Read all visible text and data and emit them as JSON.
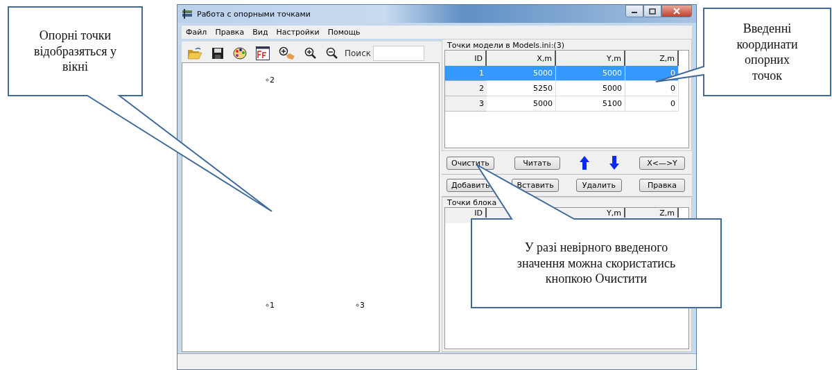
{
  "window": {
    "title": "Работа с опорными точками"
  },
  "menu": [
    {
      "label": "Файл"
    },
    {
      "label": "Правка"
    },
    {
      "label": "Вид"
    },
    {
      "label": "Настройки"
    },
    {
      "label": "Помощь"
    }
  ],
  "toolbar": {
    "tools": [
      {
        "kind": "open"
      },
      {
        "kind": "save"
      },
      {
        "kind": "palette"
      },
      {
        "kind": "font"
      },
      {
        "kind": "zoom-hand"
      },
      {
        "kind": "zoom-in"
      },
      {
        "kind": "zoom-out"
      }
    ],
    "search_label": "Поиск"
  },
  "canvas": {
    "points": [
      {
        "label": "1"
      },
      {
        "label": "2"
      },
      {
        "label": "3"
      }
    ]
  },
  "model_table": {
    "title": "Точки модели в Models.ini:(3)",
    "columns": [
      "ID",
      "X,m",
      "Y,m",
      "Z,m"
    ],
    "rows": [
      {
        "cells": [
          "1",
          "5000",
          "5000",
          "0"
        ],
        "selected": true
      },
      {
        "cells": [
          "2",
          "5250",
          "5000",
          "0"
        ],
        "selected": false
      },
      {
        "cells": [
          "3",
          "5000",
          "5100",
          "0"
        ],
        "selected": false
      }
    ]
  },
  "buttons_row_1": [
    {
      "kind": "text",
      "label": "Очистить"
    },
    {
      "kind": "text",
      "label": "Читать"
    },
    {
      "kind": "up"
    },
    {
      "kind": "down"
    },
    {
      "kind": "text",
      "label": "X<—>Y"
    }
  ],
  "buttons_row_2": [
    {
      "label": "Добавить"
    },
    {
      "label": "Вставить"
    },
    {
      "label": "Удалить"
    },
    {
      "label": "Правка"
    }
  ],
  "block_table": {
    "title": "Точки блока",
    "columns": [
      "ID",
      "Y,m",
      "Z,m"
    ]
  },
  "callouts": [
    {
      "text": "Опорні точки відобразяться у вікні"
    },
    {
      "text": "Введенні координати опорних точок"
    },
    {
      "text": "У разі невірного введеного значення можна скористатись кнопкою Очистити"
    }
  ]
}
